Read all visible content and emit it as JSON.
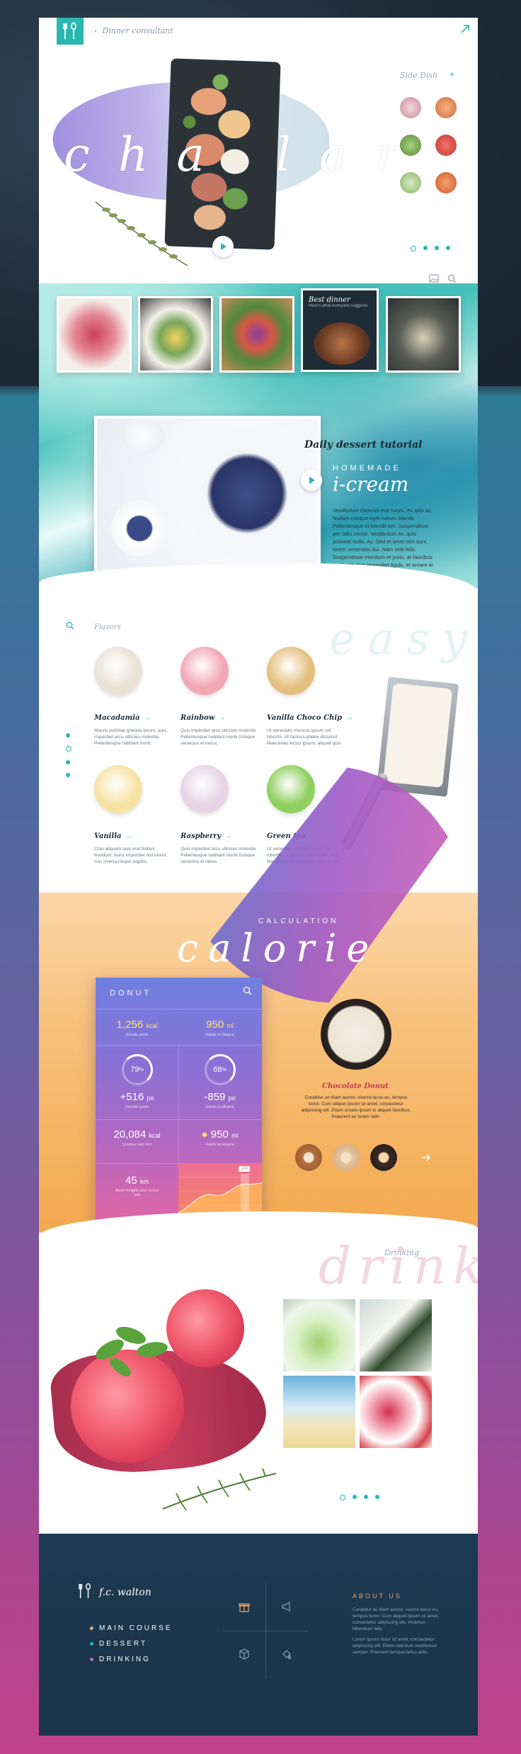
{
  "header": {
    "breadcrumb": "Dinner consultant"
  },
  "hero": {
    "title": "cha lar",
    "side_dish_label": "Side Dish"
  },
  "best_dinner": {
    "title": "Best dinner",
    "subtitle": "Here's what everyone suggests"
  },
  "dessert": {
    "label": "Daily dessert tutorial",
    "kicker": "HOMEMADE",
    "title": "i-cream",
    "paragraph": "Vestibulum rhoncus mar turpis, eu iptis ac. Nullam conque eget rutrum blandit. Pellentesque et blandit torl. Suspendisse per odio conse. Vestibulum ex, quis pulvinar nulla. Ac. Sed et amet non sunt lorem venenatis dui. Nam velit felis. Suspendisse interdum et justo, at faucibus in. Vestibulum imperdiet ligula, et ornare id ornare tortor. Suspendisse lorem sem, tempus nulls. Vivamus et purus. quis venenatis dui. Proin eget justo neque efficitur ut. Vestibulum ipsum condimentum. Praesent dolor erat."
  },
  "flavors": {
    "label": "Flavors",
    "watermark": "easy",
    "items": [
      {
        "name": "Macadamia",
        "desc": "Mauris pulvinar gravida ipsum, quis imperdiet arcu ultricies molestie. Pellentesque habitant morb.",
        "color": "#e9e2d6"
      },
      {
        "name": "Rainbow",
        "desc": "Quis imperdiet arcu ultricies molestie. Pellentesque habitant morbi tristique senectus et netus.",
        "color": "#f2a7b4"
      },
      {
        "name": "Vanilla Choco Chip",
        "desc": "Ut venenatis rhoncus ipsum vel lobortis. Ut facilisis platea dictumst. Maecenas lectus ipsum, aliquet quis.",
        "color": "#e4c07f"
      },
      {
        "name": "Vanilla",
        "desc": "Cras aliquam quis erat finibus tincidunt. Nunc imperdiet nisl lorem, non viverra neque sagittis.",
        "color": "#f6e2a2"
      },
      {
        "name": "Raspberry",
        "desc": "Quis imperdiet arcu ultricies molestie. Pellentesque habitant morbi tristique senectus et netus.",
        "color": "#e7d3e6"
      },
      {
        "name": "Green tea",
        "desc": "Ut venenatis rhoncus ipsum vel lobortis. Ut facilisis platea dictumst. Maecenas lectus ipsum, aliquet quis.",
        "color": "#8fcf5e"
      }
    ]
  },
  "calorie": {
    "kicker": "CALCULATION",
    "title": "calorie",
    "card": {
      "title": "DONUT",
      "kcal": "1,256",
      "kcal_unit": "kcal",
      "kcal_sub": "Donuts gram",
      "ml": "950",
      "ml_unit": "ml",
      "ml_sub": "Habits la kitapha",
      "pct1": "79",
      "pct2": "68",
      "po1": "+516",
      "po1_unit": "po",
      "po1_sub": "Dornde quam",
      "po2": "-859",
      "po2_unit": "po",
      "po2_sub": "Habits la kitapha",
      "kcal2": "20,084",
      "kcal2_unit": "kcal",
      "kcal2_sub": "Quisque sed orci",
      "ml2": "950",
      "ml2_unit": "ml",
      "ml2_sub": "Habits la kitapha",
      "km": "45",
      "km_unit": "km",
      "km_sub": "Morbi fringilla ante luctus sed",
      "chart_tag": "100"
    },
    "featured_name": "Chocolate Donut",
    "featured_desc": "Curabitur ac diam auctor, viverra lacus eu, tempus tortor. Cum aliquet ipsum sit amet, consectetur adipiscing elit. Etiam ornare ipsum in aliquet faucibus. Praesent eu lorem nibh."
  },
  "drinking": {
    "label": "Drinking",
    "watermark": "drink"
  },
  "footer": {
    "name": "f.c. walton",
    "nav": [
      {
        "label": "MAIN COURSE",
        "color": "#f0a36b"
      },
      {
        "label": "DESSERT",
        "color": "#2bb7b1"
      },
      {
        "label": "DRINKING",
        "color": "#b36bd6"
      }
    ],
    "about_title": "ABOUT US",
    "about_text_1": "Curabitur ac diam auctor, viverra lacus eu, tempus tortor. Cum aliquet ipsum sit amet, consectetur adipiscing elit. Vivamus bibendum felis.",
    "about_text_2": "Lorem ipsum dolor sit amet, consectetur adipiscing elit. Etiam interdum vestibulum semper. Praesent tempus tellus ante."
  },
  "colors": {
    "accent": "#2bb7b1",
    "orange": "#f4a94f",
    "footer_bg": "#1c3a52"
  }
}
